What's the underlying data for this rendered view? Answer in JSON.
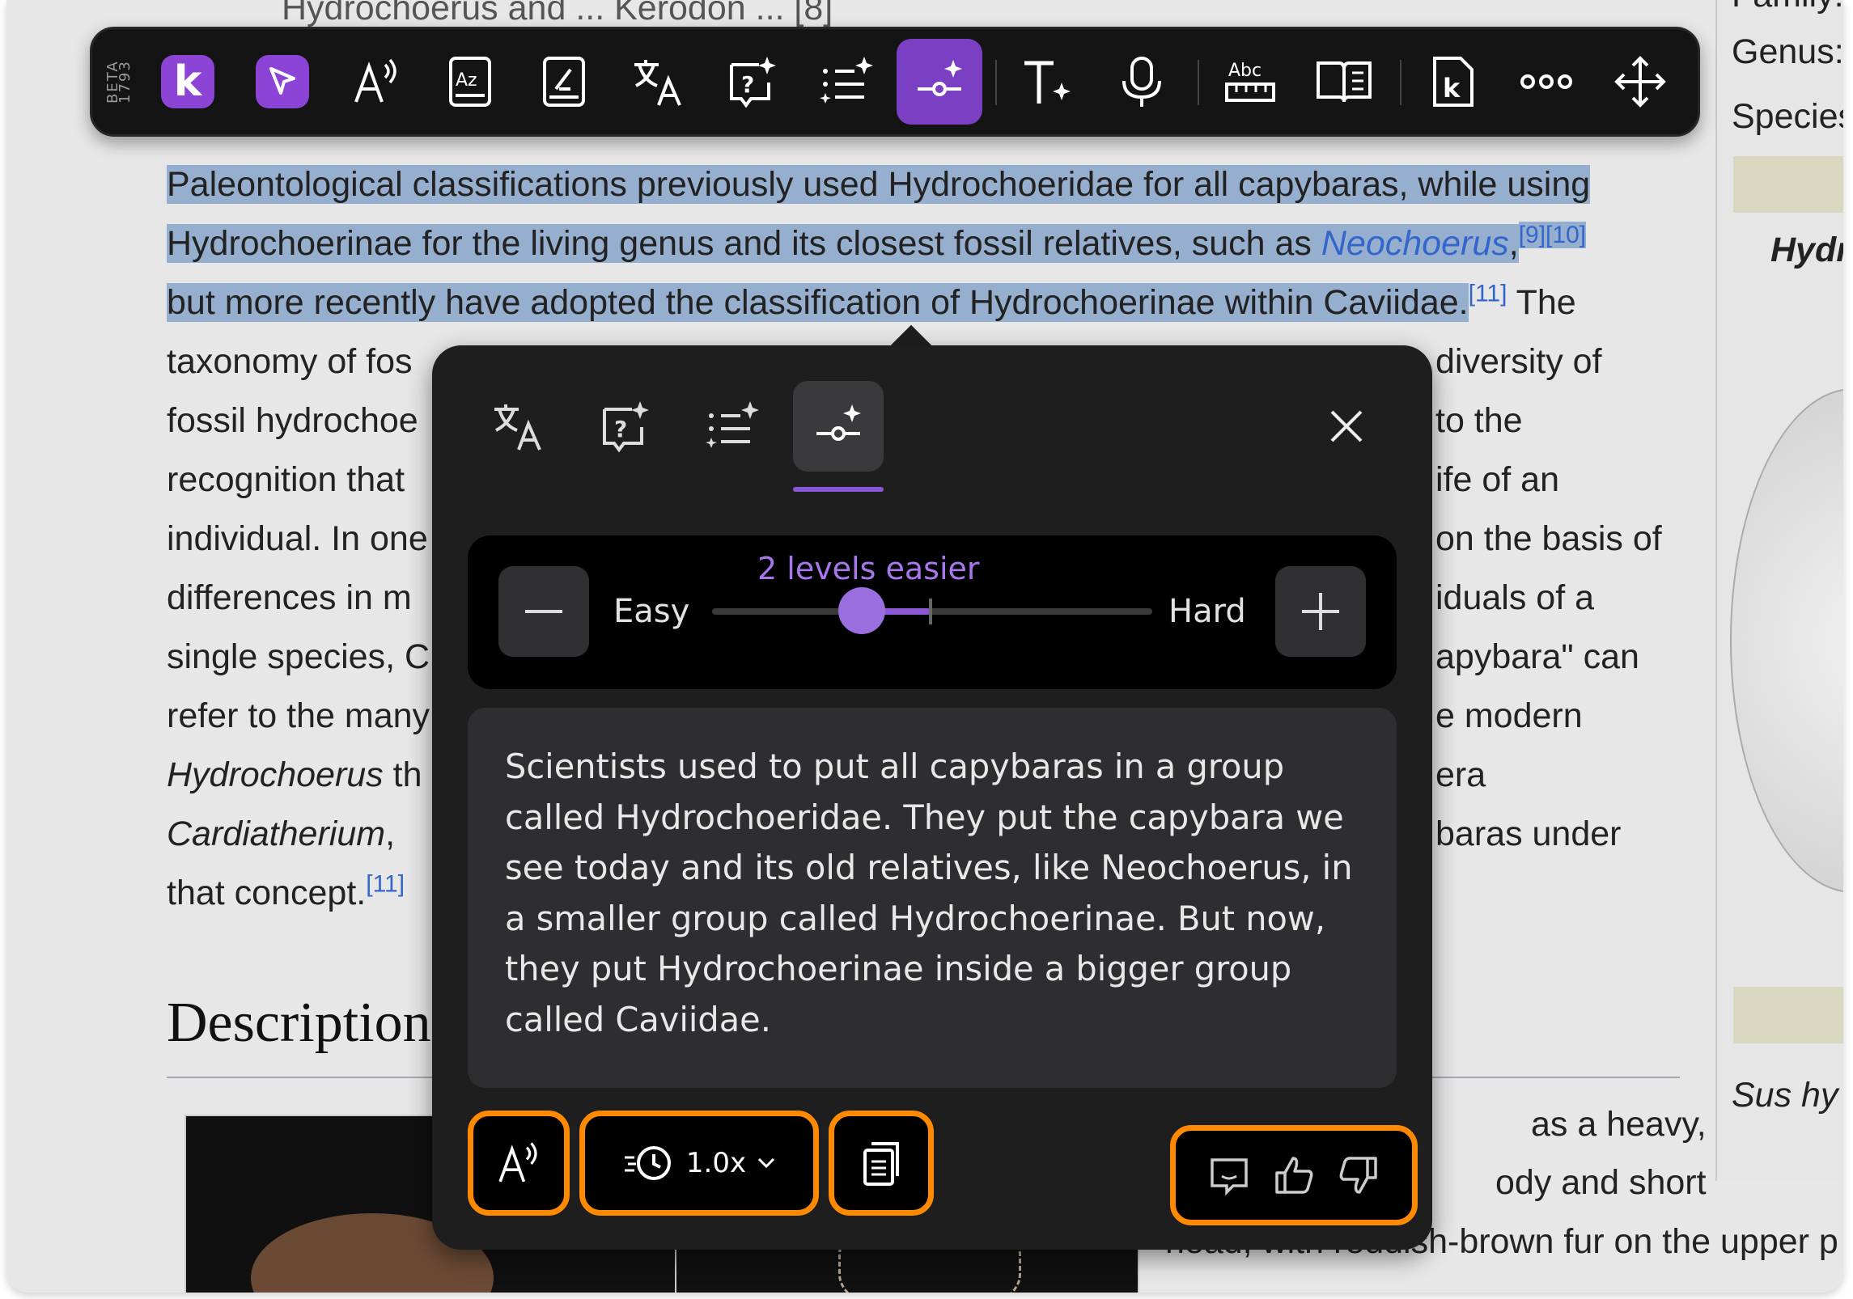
{
  "article": {
    "top_partial": "Hydrochoerus and ... Kerodon ... [8]",
    "lines": [
      {
        "parts": [
          {
            "t": "Paleontological classifications previously used Hydrochoeridae for all capybaras, while using",
            "c": "hl"
          }
        ]
      },
      {
        "parts": [
          {
            "t": "Hydrochoerinae for the living genus and its closest fossil relatives, such as ",
            "c": "hl"
          },
          {
            "t": "Neochoerus",
            "c": "hl link"
          },
          {
            "t": ",",
            "c": "hl"
          },
          {
            "t": "[9][10]",
            "c": "hl ref"
          }
        ]
      },
      {
        "parts": [
          {
            "t": "but more recently have adopted the classification of Hydrochoerinae within Caviidae.",
            "c": "hl"
          },
          {
            "t": "[11]",
            "c": "ref"
          },
          {
            "t": " The",
            "c": ""
          }
        ]
      },
      {
        "parts": [
          {
            "t": "taxonomy of fos",
            "c": ""
          }
        ],
        "right": "diversity of"
      },
      {
        "parts": [
          {
            "t": "fossil hydrochoe",
            "c": ""
          }
        ],
        "right": "to the"
      },
      {
        "parts": [
          {
            "t": "recognition that",
            "c": ""
          }
        ],
        "right": "ife of an"
      },
      {
        "parts": [
          {
            "t": "individual. In one",
            "c": ""
          }
        ],
        "right": "on the basis of"
      },
      {
        "parts": [
          {
            "t": "differences in m",
            "c": ""
          }
        ],
        "right": "iduals of a"
      },
      {
        "parts": [
          {
            "t": "single species, C",
            "c": ""
          }
        ],
        "right": "apybara\" can"
      },
      {
        "parts": [
          {
            "t": "refer to the many",
            "c": ""
          }
        ],
        "right": "e modern"
      },
      {
        "parts": [
          {
            "t": "Hydrochoerus",
            "c": "ital"
          },
          {
            "t": " th",
            "c": ""
          }
        ],
        "right": "era"
      },
      {
        "parts": [
          {
            "t": "Cardiatherium",
            "c": "ital"
          },
          {
            "t": ", ",
            "c": ""
          }
        ],
        "right": "baras under"
      },
      {
        "parts": [
          {
            "t": "that concept.",
            "c": ""
          },
          {
            "t": "[11]",
            "c": "ref"
          }
        ],
        "right": ""
      }
    ],
    "heading": "Description",
    "desc_lines": [
      {
        "t": "as a heavy,"
      },
      {
        "t": "ody and short"
      },
      {
        "t": "head, with reddish-brown fur on the upper p"
      }
    ]
  },
  "infobox": {
    "family": "Family:",
    "genus": "Genus:",
    "species": "Species",
    "title_partial": "Hydr",
    "binomial_partial": "Sus hy"
  },
  "toolbar": {
    "beta_label": "BETA 1793",
    "tools": [
      "kami-logo",
      "select-tool",
      "read-aloud",
      "dictionary",
      "reading-mode",
      "translate",
      "ask-question",
      "summarize",
      "simplify",
      "text-style",
      "dictation",
      "spelling",
      "immersive-reader",
      "kami-app",
      "more",
      "move"
    ]
  },
  "popup": {
    "tabs": [
      "translate",
      "ask-question",
      "summarize",
      "simplify"
    ],
    "active_tab": "simplify",
    "level": {
      "hint": "2 levels easier",
      "easy_label": "Easy",
      "hard_label": "Hard",
      "value_fraction": 0.34
    },
    "simplified_text": "Scientists used to put all capybaras in a group called Hydrochoeridae. They put the capybara we see today and its old relatives, like Neochoerus, in a smaller group called Hydrochoerinae. But now, they put Hydrochoerinae inside a bigger group called Caviidae.",
    "speed_label": "1.0x",
    "highlight_color": "#ff8a00",
    "accent_color": "#8b44d6"
  }
}
